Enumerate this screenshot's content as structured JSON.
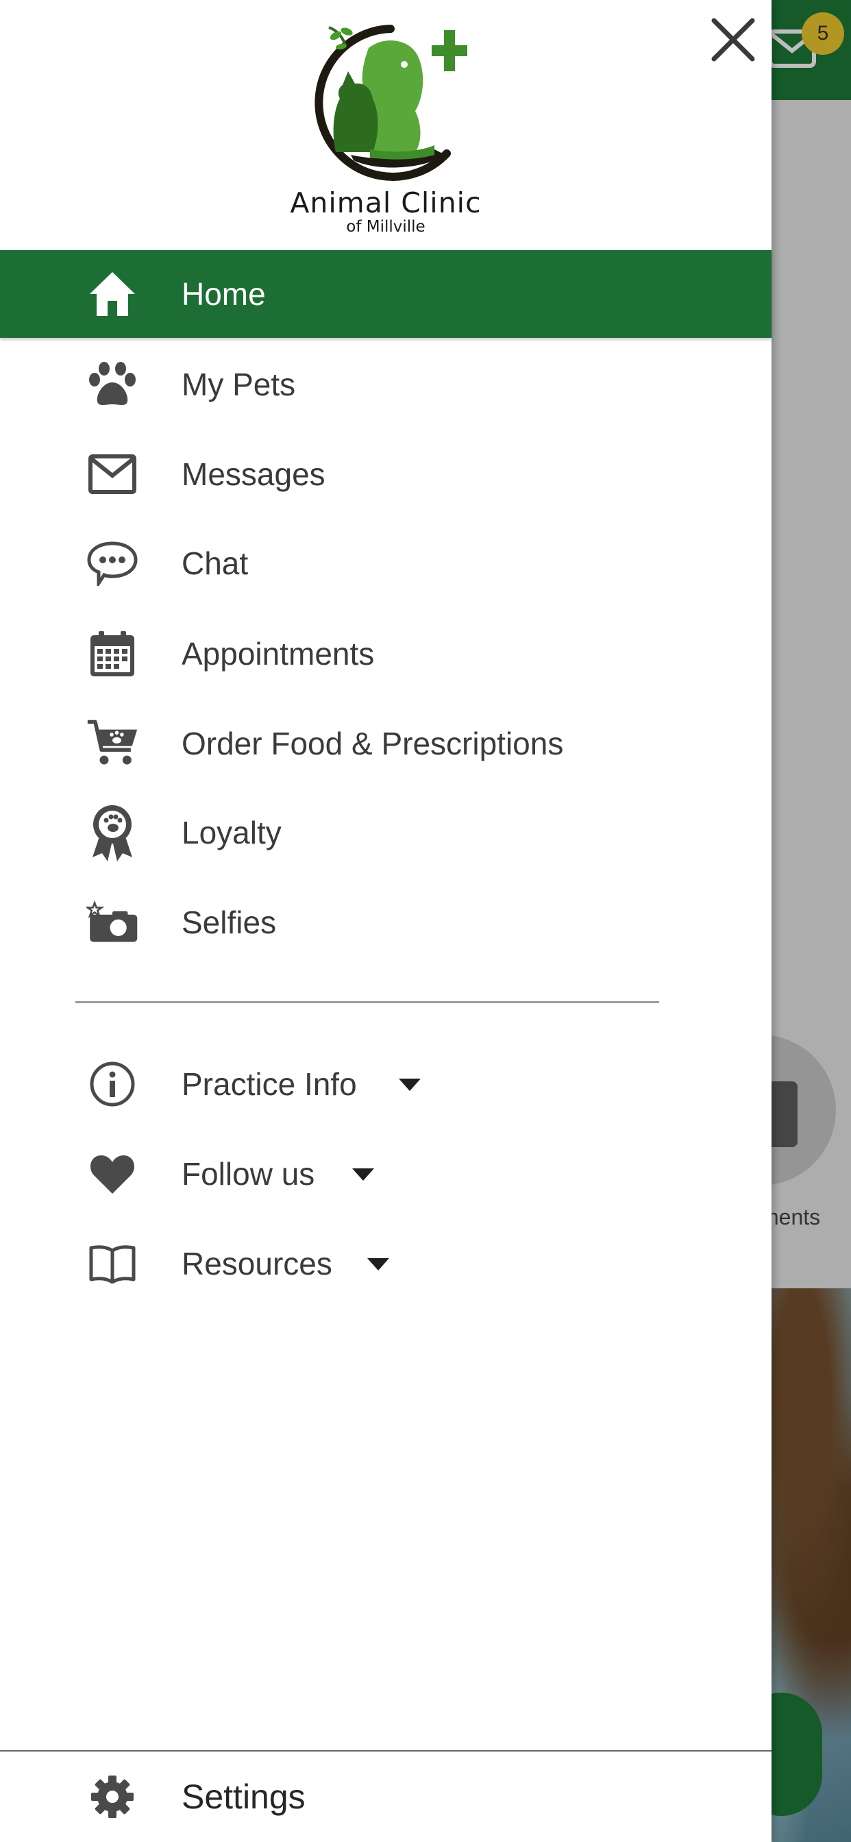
{
  "background": {
    "badge_count": "5",
    "caption_fragment": "ments"
  },
  "drawer": {
    "logo": {
      "title": "Animal Clinic",
      "subtitle": "of Millville"
    },
    "items": [
      {
        "label": "Home",
        "icon": "home-icon",
        "active": true
      },
      {
        "label": "My Pets",
        "icon": "paw-icon"
      },
      {
        "label": "Messages",
        "icon": "envelope-icon"
      },
      {
        "label": "Chat",
        "icon": "chat-bubble-icon"
      },
      {
        "label": "Appointments",
        "icon": "calendar-icon"
      },
      {
        "label": "Order Food & Prescriptions",
        "icon": "cart-icon"
      },
      {
        "label": "Loyalty",
        "icon": "award-ribbon-icon"
      },
      {
        "label": "Selfies",
        "icon": "camera-icon"
      }
    ],
    "sections": [
      {
        "label": "Practice Info",
        "icon": "info-icon"
      },
      {
        "label": "Follow us",
        "icon": "heart-icon"
      },
      {
        "label": "Resources",
        "icon": "book-icon"
      }
    ],
    "settings": {
      "label": "Settings",
      "icon": "gear-icon"
    }
  },
  "colors": {
    "brand_green": "#1c6e34",
    "badge": "#d8b72a",
    "icon_gray": "#4a4a4a"
  }
}
